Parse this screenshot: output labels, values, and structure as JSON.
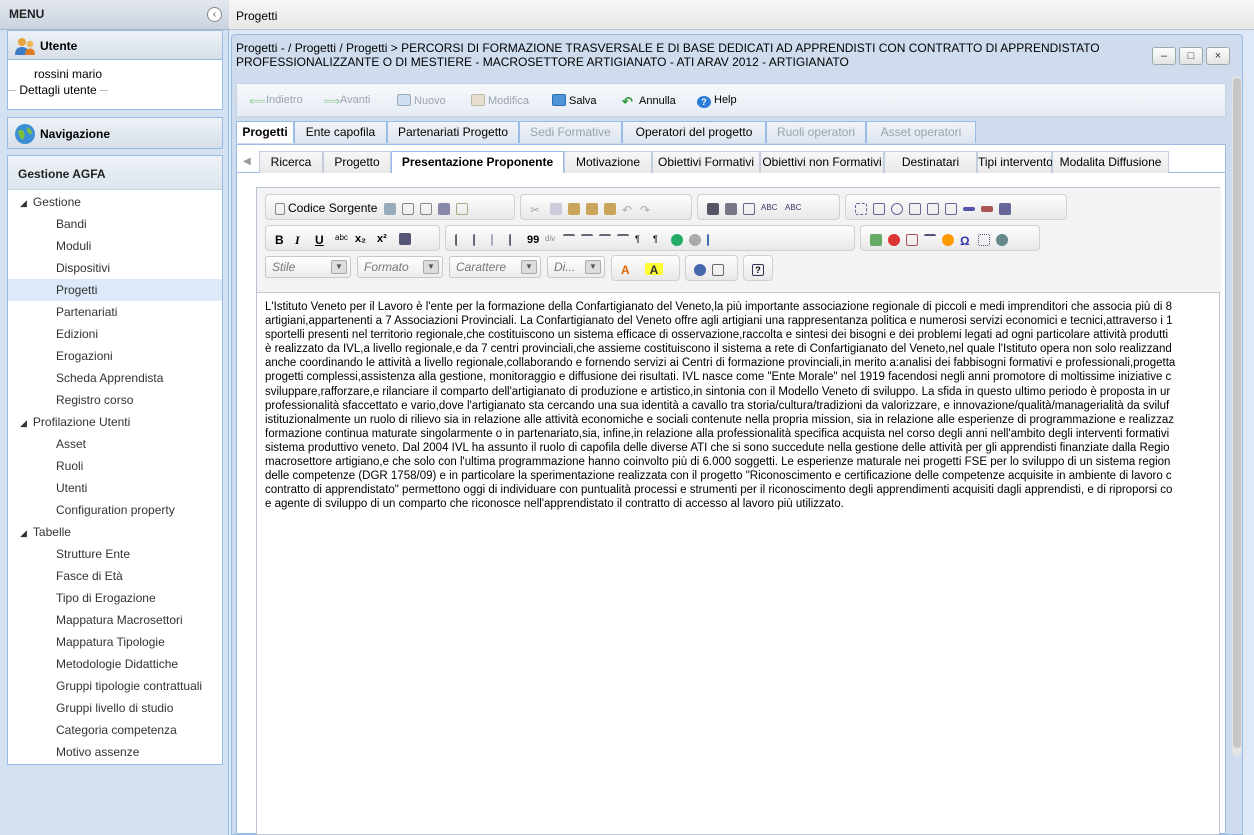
{
  "sidebar": {
    "menu_title": "MENU",
    "user_panel": {
      "title": "Utente",
      "name": "rossini mario",
      "details": "Dettagli utente"
    },
    "nav_panel": {
      "title": "Navigazione"
    },
    "tree": {
      "title": "Gestione AGFA",
      "groups": [
        {
          "label": "Gestione",
          "items": [
            "Bandi",
            "Moduli",
            "Dispositivi",
            "Progetti",
            "Partenariati",
            "Edizioni",
            "Erogazioni",
            "Scheda Apprendista",
            "Registro corso"
          ]
        },
        {
          "label": "Profilazione Utenti",
          "items": [
            "Asset",
            "Ruoli",
            "Utenti",
            "Configuration property"
          ]
        },
        {
          "label": "Tabelle",
          "items": [
            "Strutture Ente",
            "Fasce di Età",
            "Tipo di Erogazione",
            "Mappatura Macrosettori",
            "Mappatura Tipologie",
            "Metodologie Didattiche",
            "Gruppi tipologie contrattuali",
            "Gruppi livello di studio",
            "Categoria competenza",
            "Motivo assenze"
          ]
        }
      ],
      "selected": "Progetti"
    }
  },
  "topbar": {
    "title": "Progetti"
  },
  "window": {
    "title_line1": "Progetti - / Progetti / Progetti > PERCORSI DI FORMAZIONE TRASVERSALE E DI BASE DEDICATI AD APPRENDISTI CON CONTRATTO DI APPRENDISTATO",
    "title_line2": "PROFESSIONALIZZANTE O DI MESTIERE - MACROSETTORE ARTIGIANATO - ATI ARAV 2012 - ARTIGIANATO",
    "buttons": {
      "minimize": "–",
      "maximize": "□",
      "close": "×"
    }
  },
  "toolbar": {
    "back": "Indietro",
    "forward": "Avanti",
    "new": "Nuovo",
    "edit": "Modifica",
    "save": "Salva",
    "cancel": "Annulla",
    "help": "Help"
  },
  "tabs": [
    "Progetti",
    "Ente capofila",
    "Partenariati Progetto",
    "Sedi Formative",
    "Operatori del progetto",
    "Ruoli operatori",
    "Asset operatori"
  ],
  "subtabs": [
    "Ricerca",
    "Progetto",
    "Presentazione Proponente",
    "Motivazione",
    "Obiettivi Formativi",
    "Obiettivi non Formativi",
    "Destinatari",
    "Tipi intervento",
    "Modalita Diffusione"
  ],
  "editor": {
    "source_label": "Codice Sorgente",
    "combos": {
      "style": "Stile",
      "format": "Formato",
      "font": "Carattere",
      "size": "Di..."
    },
    "text": "L'Istituto Veneto per il Lavoro è l'ente per la formazione della Confartigianato del Veneto,la più importante associazione regionale di piccoli e medi imprenditori che associa più di 8\nartigiani,appartenenti a 7 Associazioni Provinciali. La Confartigianato del Veneto offre agli artigiani una rappresentanza politica e numerosi servizi economici e tecnici,attraverso i 1\nsportelli presenti nel territorio regionale,che costituiscono un sistema efficace di osservazione,raccolta e sintesi dei bisogni e dei problemi legati ad ogni particolare attività produtti\nè realizzato da IVL,a livello regionale,e da 7 centri provinciali,che assieme costituiscono il sistema a rete di Confartigianato del Veneto,nel quale l'Istituto opera non solo realizzand\nanche coordinando le attività a livello regionale,collaborando e fornendo servizi ai Centri di formazione provinciali,in merito a:analisi dei fabbisogni formativi e professionali,progetta\nprogetti complessi,assistenza alla gestione, monitoraggio e diffusione dei risultati. IVL nasce come \"Ente Morale\" nel 1919 facendosi negli anni promotore di moltissime iniziative c\nsviluppare,rafforzare,e rilanciare il comparto dell'artigianato di produzione e artistico,in sintonia con il Modello Veneto di sviluppo. La sfida in questo ultimo periodo è proposta in ur\nprofessionalità sfaccettato e vario,dove l'artigianato sta cercando una sua identità a cavallo tra storia/cultura/tradizioni da valorizzare, e innovazione/qualità/managerialità da sviluf\nistituzionalmente un ruolo di rilievo sia in relazione alle attività economiche e sociali contenute nella propria mission, sia in relazione alle esperienze di programmazione e realizzaz\nformazione continua maturate singolarmente o in partenariato,sia, infine,in relazione alla professionalità specifica acquista nel corso degli anni nell'ambito degli interventi formativi\nsistema produttivo veneto. Dal 2004 IVL ha assunto il ruolo di capofila delle diverse ATI che si sono succedute nella gestione delle attività per gli apprendisti finanziate dalla Regio\nmacrosettore artigiano,e che solo con l'ultima programmazione hanno coinvolto più di 6.000 soggetti. Le esperienze maturale nei progetti FSE per lo sviluppo di un sistema region\ndelle competenze (DGR 1758/09) e in particolare la sperimentazione realizzata con il progetto \"Riconoscimento e certificazione delle competenze acquisite in ambiente di lavoro c\ncontratto di apprendistato\" permettono oggi di individuare con puntualità processi e strumenti per il riconoscimento degli apprendimenti acquisiti dagli apprendisti, e di riproporsi co\ne agente di sviluppo di un comparto che riconosce nell'apprendistato il contratto di accesso al lavoro più utilizzato."
  },
  "colors": {
    "accent": "#99bbe8",
    "selected_row": "#dce9f9",
    "disabled_text": "#9aa3ad"
  }
}
